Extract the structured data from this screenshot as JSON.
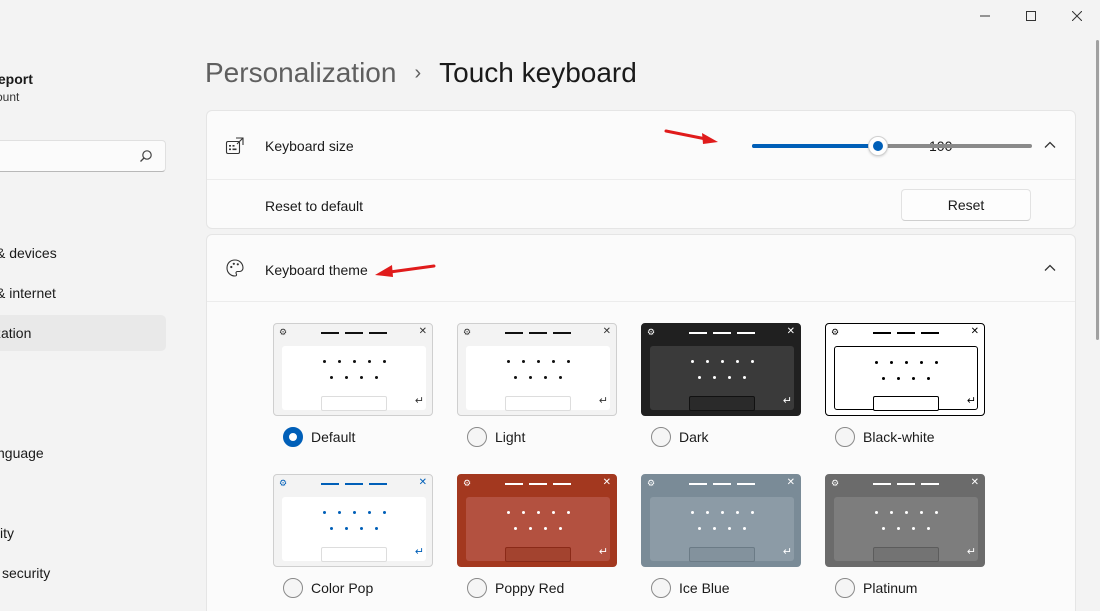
{
  "window": {
    "minimize": "—",
    "maximize": "☐",
    "close": "✕"
  },
  "account": {
    "name": "dowsReport",
    "type": "Account"
  },
  "sidebar": {
    "search_placeholder": "",
    "items": [
      {
        "label": "& devices",
        "active": false
      },
      {
        "label": "& internet",
        "active": false
      },
      {
        "label": "zation",
        "active": true
      },
      {
        "label": "nguage",
        "active": false
      },
      {
        "label": "ity",
        "active": false
      },
      {
        "label": "security",
        "active": false
      }
    ]
  },
  "header": {
    "parent": "Personalization",
    "separator": "›",
    "current": "Touch keyboard"
  },
  "keyboard_size": {
    "label": "Keyboard size",
    "value": "100",
    "fraction": 0.45
  },
  "reset": {
    "label": "Reset to default",
    "button": "Reset"
  },
  "keyboard_theme": {
    "label": "Keyboard theme",
    "themes": [
      {
        "name": "Default",
        "selected": true
      },
      {
        "name": "Light",
        "selected": false
      },
      {
        "name": "Dark",
        "selected": false
      },
      {
        "name": "Black-white",
        "selected": false
      },
      {
        "name": "Color Pop",
        "selected": false
      },
      {
        "name": "Poppy Red",
        "selected": false
      },
      {
        "name": "Ice Blue",
        "selected": false
      },
      {
        "name": "Platinum",
        "selected": false
      }
    ]
  },
  "colors": {
    "accent": "#005fb8",
    "annotation_arrow": "#e01b1b"
  }
}
